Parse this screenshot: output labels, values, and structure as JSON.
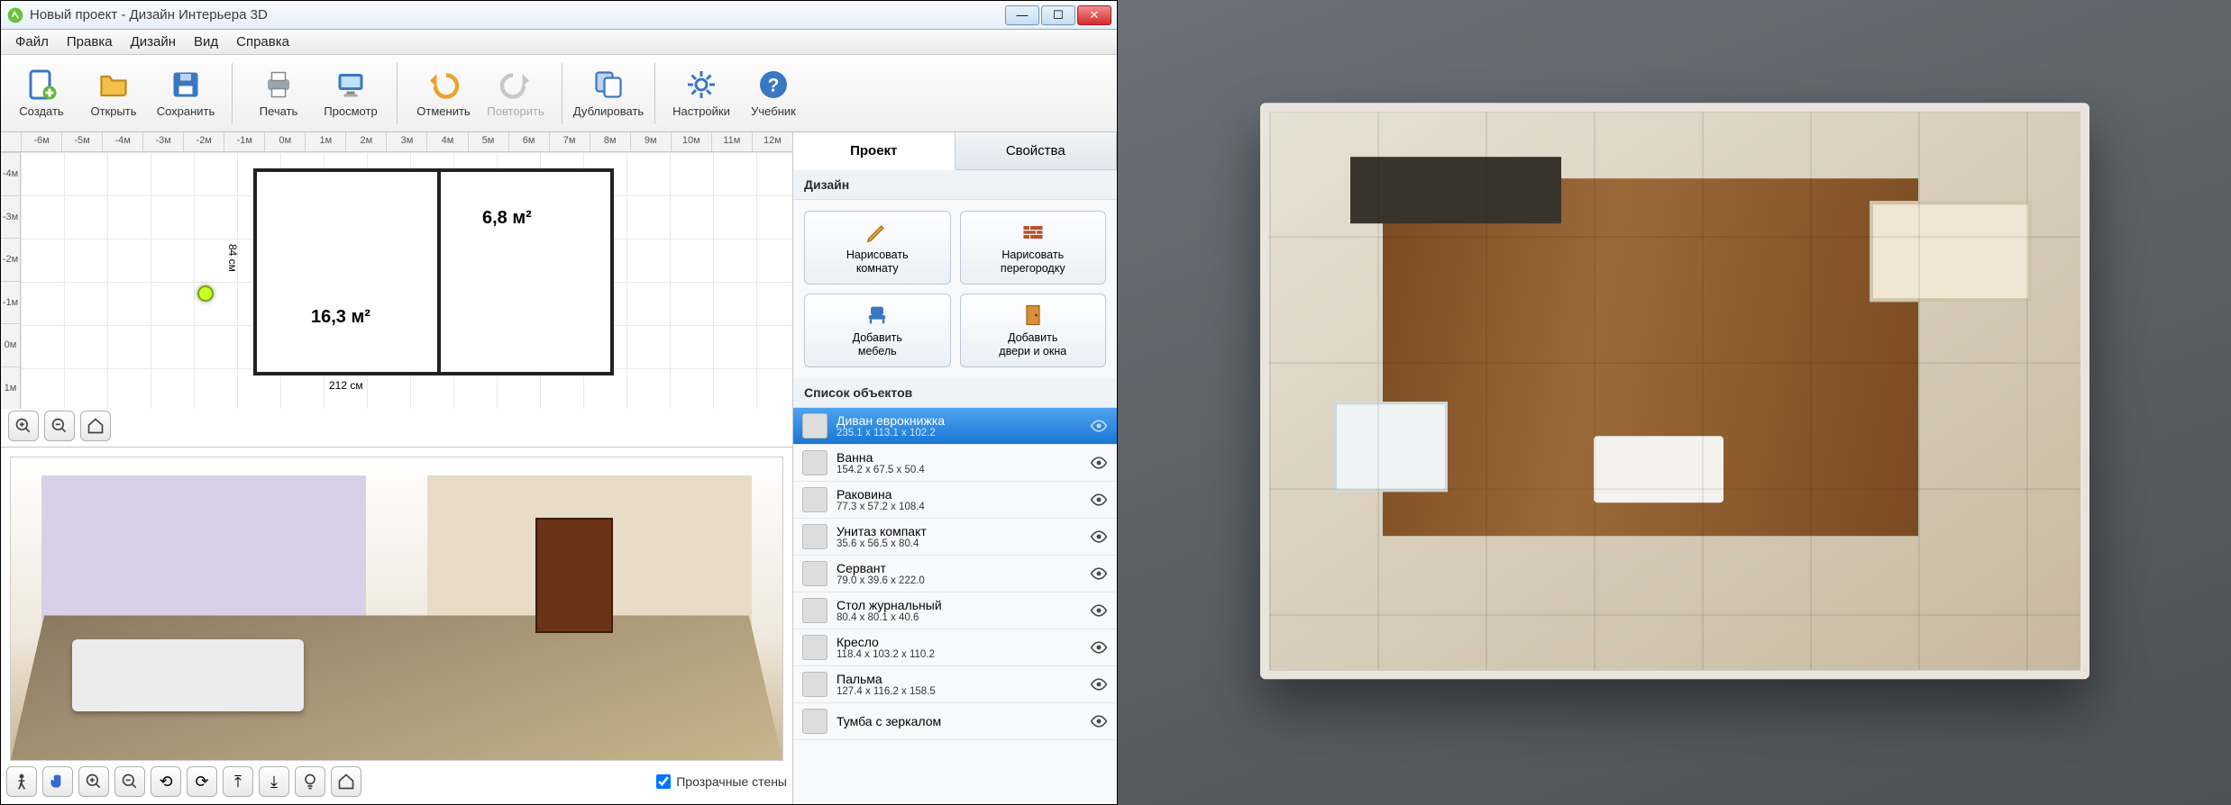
{
  "window": {
    "title": "Новый проект - Дизайн Интерьера 3D"
  },
  "menu": {
    "file": "Файл",
    "edit": "Правка",
    "design": "Дизайн",
    "view": "Вид",
    "help": "Справка"
  },
  "toolbar": {
    "create": "Создать",
    "open": "Открыть",
    "save": "Сохранить",
    "print": "Печать",
    "preview": "Просмотр",
    "undo": "Отменить",
    "redo": "Повторить",
    "duplicate": "Дублировать",
    "settings": "Настройки",
    "tutorial": "Учебник"
  },
  "ruler_h": [
    "-6м",
    "-5м",
    "-4м",
    "-3м",
    "-2м",
    "-1м",
    "0м",
    "1м",
    "2м",
    "3м",
    "4м",
    "5м",
    "6м",
    "7м",
    "8м",
    "9м",
    "10м",
    "11м",
    "12м"
  ],
  "ruler_v": [
    "-4м",
    "-3м",
    "-2м",
    "-1м",
    "0м",
    "1м"
  ],
  "plan": {
    "room1_area": "16,3 м²",
    "room2_area": "6,8 м²",
    "dim_left": "84 см",
    "dim_bottom": "212 см"
  },
  "side": {
    "tab_project": "Проект",
    "tab_props": "Свойства",
    "section_design": "Дизайн",
    "design_buttons": {
      "draw_room": "Нарисовать\nкомнату",
      "draw_partition": "Нарисовать\nперегородку",
      "add_furniture": "Добавить\nмебель",
      "add_doors": "Добавить\nдвери и окна"
    },
    "section_objects": "Список объектов",
    "objects": [
      {
        "name": "Диван еврокнижка",
        "dims": "235.1 x 113.1 x 102.2",
        "selected": true
      },
      {
        "name": "Ванна",
        "dims": "154.2 x 67.5 x 50.4"
      },
      {
        "name": "Раковина",
        "dims": "77.3 x 57.2 x 108.4"
      },
      {
        "name": "Унитаз компакт",
        "dims": "35.6 x 56.5 x 80.4"
      },
      {
        "name": "Сервант",
        "dims": "79.0 x 39.6 x 222.0"
      },
      {
        "name": "Стол журнальный",
        "dims": "80.4 x 80.1 x 40.6"
      },
      {
        "name": "Кресло",
        "dims": "118.4 x 103.2 x 110.2"
      },
      {
        "name": "Пальма",
        "dims": "127.4 x 116.2 x 158.5"
      },
      {
        "name": "Тумба с зеркалом",
        "dims": ""
      }
    ]
  },
  "controls": {
    "transparent_walls": "Прозрачные стены"
  }
}
